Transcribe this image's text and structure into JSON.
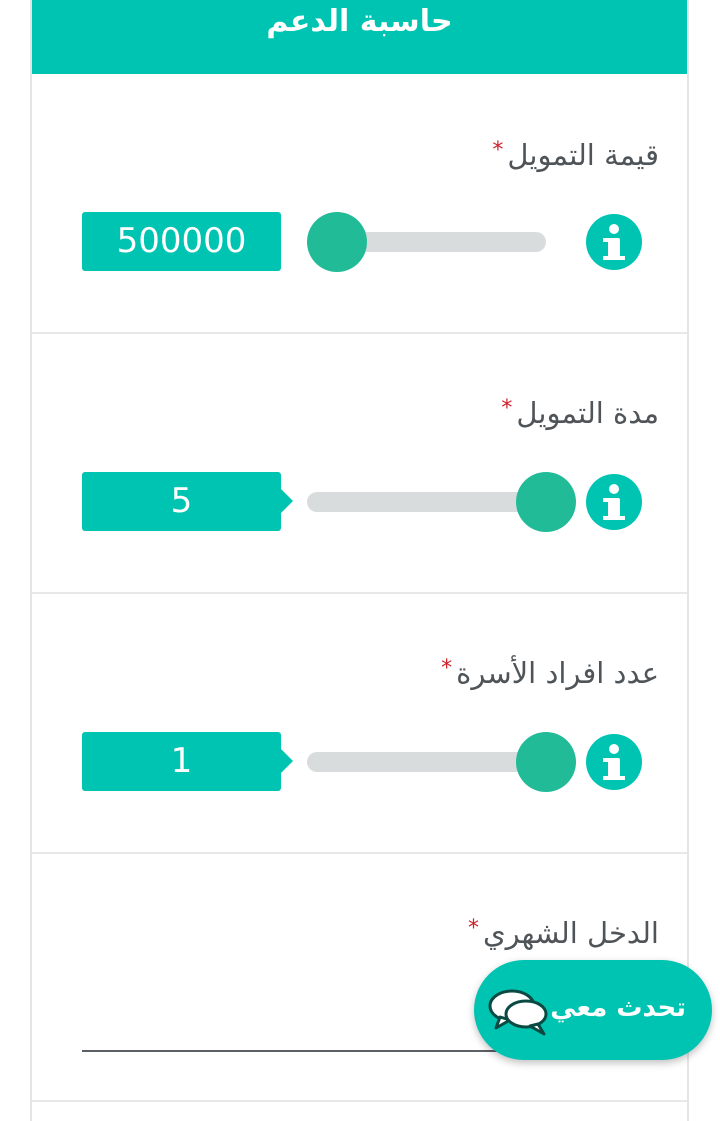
{
  "header": {
    "title": "حاسبة الدعم"
  },
  "fields": {
    "financing_amount": {
      "label": "قيمة التمويل",
      "required_mark": "*",
      "value": "500000",
      "slider_fraction": 0.0
    },
    "financing_period": {
      "label": "مدة التمويل",
      "required_mark": "*",
      "value": "5",
      "slider_fraction": 1.0
    },
    "family_members": {
      "label": "عدد افراد الأسرة",
      "required_mark": "*",
      "value": "1",
      "slider_fraction": 1.0
    },
    "monthly_income": {
      "label": "الدخل الشهري",
      "required_mark": "*",
      "value": ""
    }
  },
  "chat": {
    "label": "تحدث معي",
    "icon": "chat-bubbles-icon"
  },
  "icons": {
    "info": "info-icon"
  },
  "colors": {
    "accent": "#00c4b2",
    "thumb": "#22bb98",
    "track": "#d8dcdd",
    "required": "#d0202a"
  }
}
